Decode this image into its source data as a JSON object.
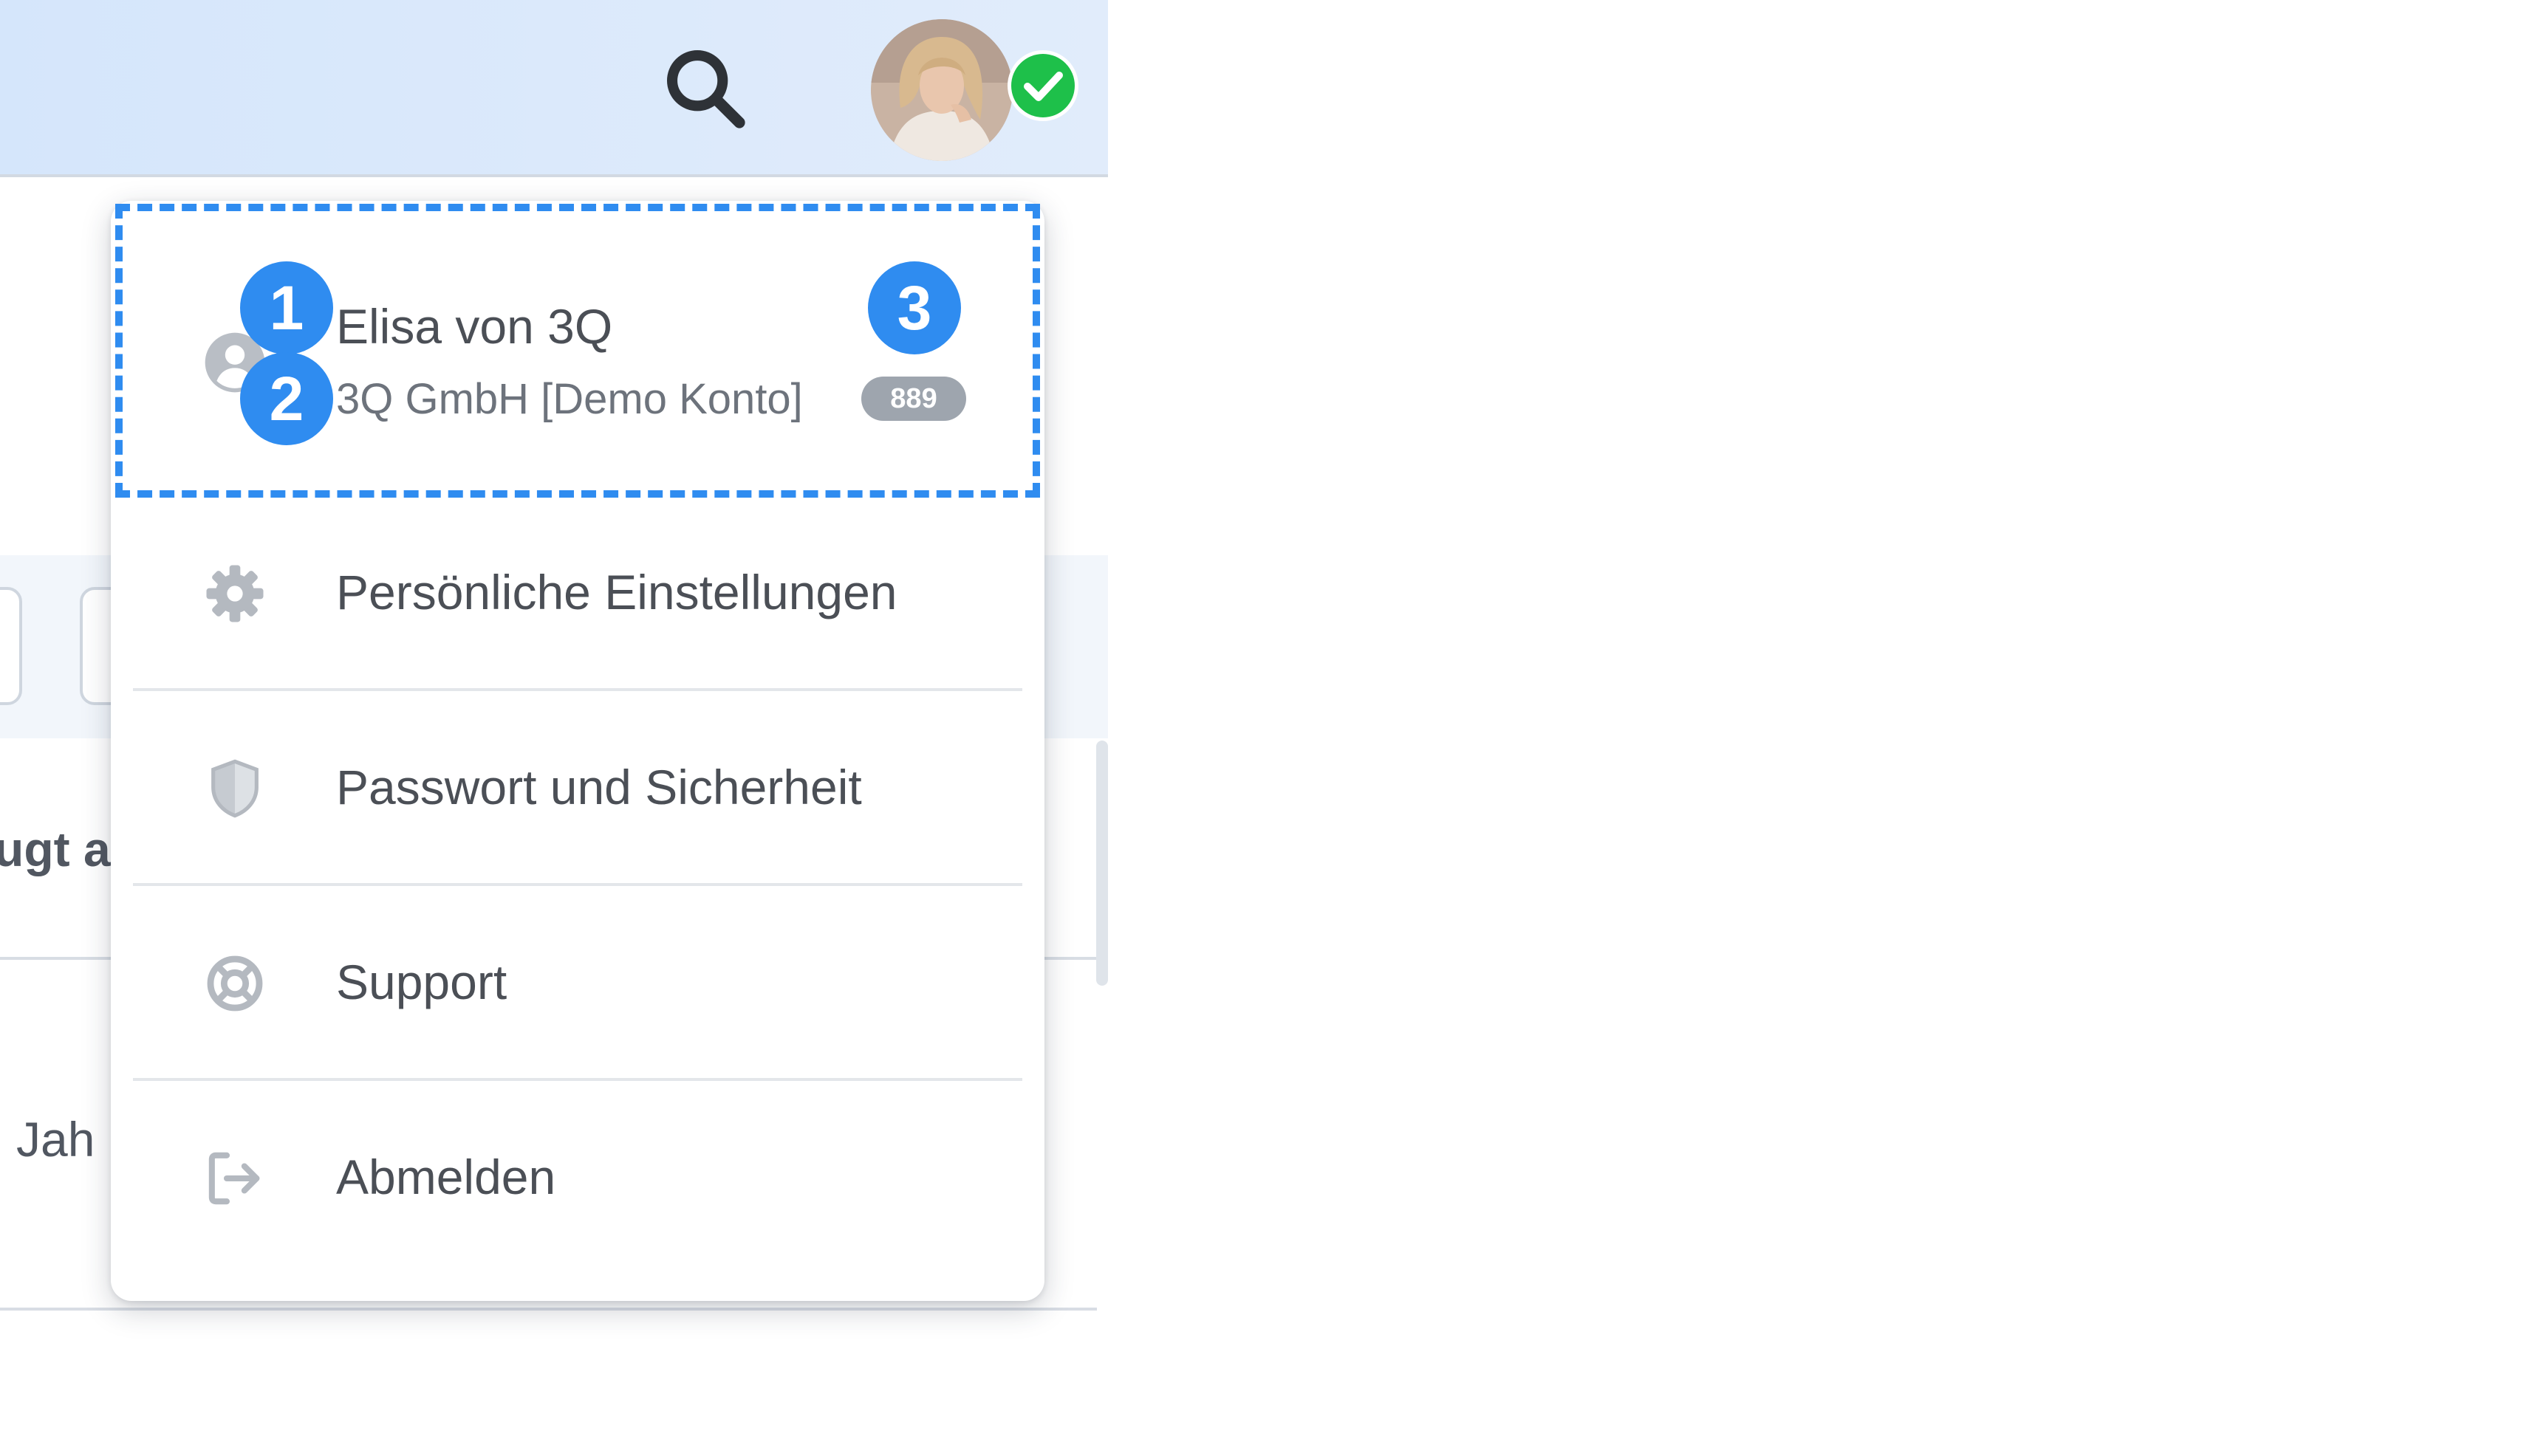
{
  "header": {
    "search_icon": "search-icon",
    "avatar": "user-avatar",
    "online_status_icon": "check-circle-icon",
    "status_color": "#1ec04a"
  },
  "background": {
    "row_text_1": "ugt a",
    "row_text_2": "Jah"
  },
  "user_menu": {
    "account": {
      "icon": "user-circle-icon",
      "name": "Elisa von 3Q",
      "organization": "3Q GmbH [Demo Konto]",
      "organization_id_badge": "889"
    },
    "items": [
      {
        "icon": "gear-icon",
        "label": "Persönliche Einstellungen"
      },
      {
        "icon": "shield-icon",
        "label": "Passwort und Sicherheit"
      },
      {
        "icon": "lifebuoy-icon",
        "label": "Support"
      },
      {
        "icon": "logout-icon",
        "label": "Abmelden"
      }
    ]
  },
  "annotations": {
    "markers": [
      "1",
      "2",
      "3"
    ],
    "highlight_color": "#2f8cf0"
  }
}
